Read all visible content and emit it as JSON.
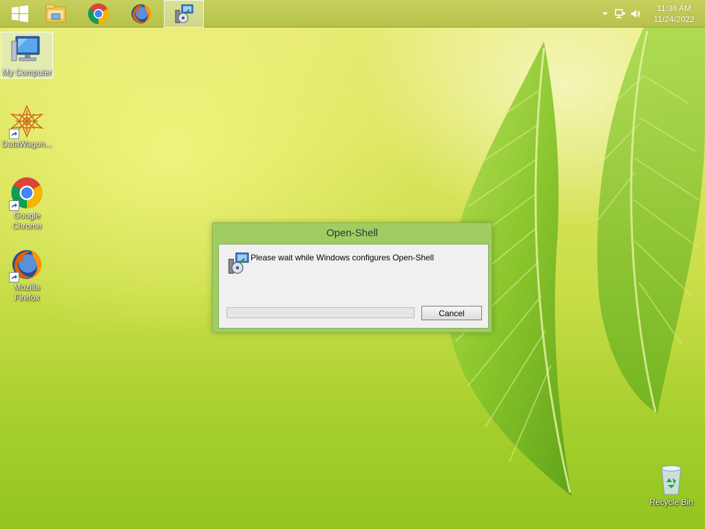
{
  "taskbar": {
    "pinned": [
      {
        "name": "windows-start",
        "icon": "windows-logo-icon"
      },
      {
        "name": "file-explorer",
        "icon": "folder-icon"
      },
      {
        "name": "google-chrome",
        "icon": "chrome-icon"
      },
      {
        "name": "mozilla-firefox",
        "icon": "firefox-icon"
      },
      {
        "name": "open-shell-setup",
        "icon": "installer-icon",
        "active": true
      }
    ],
    "tray": {
      "icons": [
        "chevron-up-icon",
        "network-icon",
        "speaker-icon"
      ],
      "time": "11:38 AM",
      "date": "11/24/2022"
    }
  },
  "desktop": {
    "icons": [
      {
        "label": "My Computer",
        "icon": "computer-icon",
        "selected": true
      },
      {
        "label": "DataWagon...",
        "icon": "datawagon-icon",
        "shortcut": true
      },
      {
        "label": "Google Chrome",
        "icon": "chrome-icon",
        "shortcut": true
      },
      {
        "label": "Mozilla Firefox",
        "icon": "firefox-icon",
        "shortcut": true
      },
      {
        "label": "Recycle Bin",
        "icon": "recycle-bin-icon"
      }
    ]
  },
  "dialog": {
    "title": "Open-Shell",
    "message": "Please wait while Windows configures Open-Shell",
    "progress": 0,
    "cancel_label": "Cancel"
  },
  "colors": {
    "accent": "#9fcd62",
    "progress_fill": "#06b025"
  }
}
